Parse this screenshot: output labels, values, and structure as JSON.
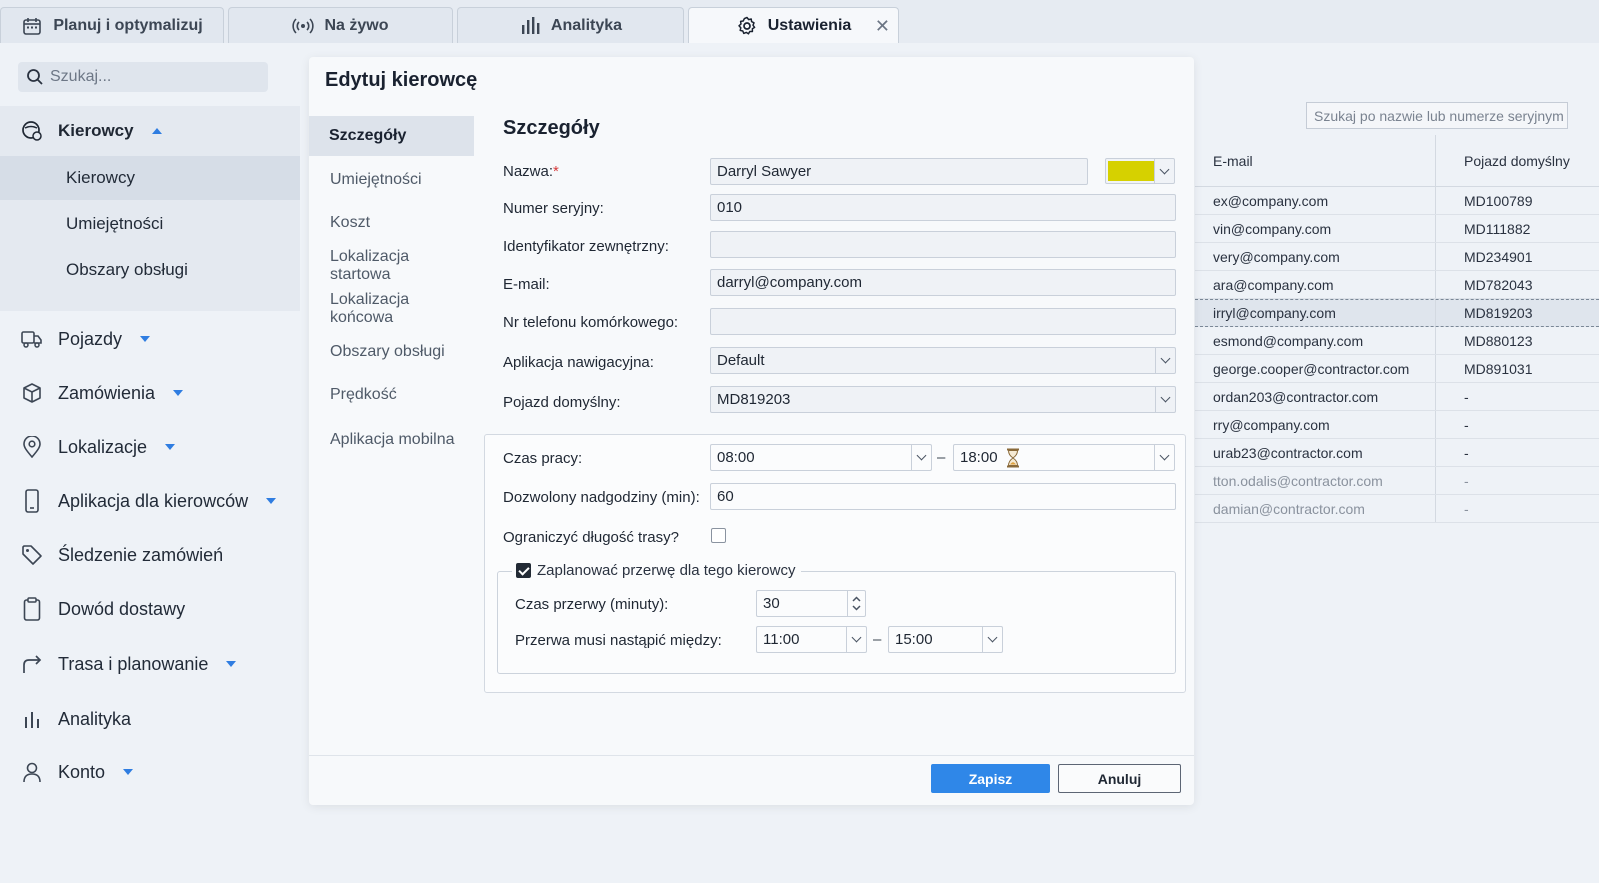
{
  "tabs": [
    {
      "label": "Planuj i optymalizuj",
      "icon": "calendar-icon"
    },
    {
      "label": "Na żywo",
      "icon": "broadcast-icon"
    },
    {
      "label": "Analityka",
      "icon": "bar-chart-icon"
    },
    {
      "label": "Ustawienia",
      "icon": "gear-icon",
      "active": true
    }
  ],
  "sidebar": {
    "search_placeholder": "Szukaj...",
    "group": {
      "label": "Kierowcy",
      "items": [
        "Kierowcy",
        "Umiejętności",
        "Obszary obsługi"
      ],
      "selected": "Kierowcy"
    },
    "items": [
      {
        "label": "Pojazdy",
        "icon": "truck-icon",
        "expandable": true
      },
      {
        "label": "Zamówienia",
        "icon": "box-icon",
        "expandable": true
      },
      {
        "label": "Lokalizacje",
        "icon": "location-pin-icon",
        "expandable": true
      },
      {
        "label": "Aplikacja dla kierowców",
        "icon": "phone-icon",
        "expandable": true
      },
      {
        "label": "Śledzenie zamówień",
        "icon": "tag-icon",
        "expandable": false
      },
      {
        "label": "Dowód dostawy",
        "icon": "clipboard-icon",
        "expandable": false
      },
      {
        "label": "Trasa i planowanie",
        "icon": "route-arrow-icon",
        "expandable": true
      },
      {
        "label": "Analityka",
        "icon": "bar-chart-icon",
        "expandable": false
      },
      {
        "label": "Konto",
        "icon": "user-icon",
        "expandable": true
      }
    ]
  },
  "background_table": {
    "search_placeholder": "Szukaj po nazwie lub numerze seryjnym",
    "columns": [
      "E-mail",
      "Pojazd domyślny"
    ],
    "rows": [
      [
        "ex@company.com",
        "MD100789"
      ],
      [
        "vin@company.com",
        "MD111882"
      ],
      [
        "very@company.com",
        "MD234901"
      ],
      [
        "ara@company.com",
        "MD782043"
      ],
      [
        "irryl@company.com",
        "MD819203"
      ],
      [
        "esmond@company.com",
        "MD880123"
      ],
      [
        "george.cooper@contractor.com",
        "MD891031"
      ],
      [
        "ordan203@contractor.com",
        "-"
      ],
      [
        "rry@company.com",
        "-"
      ],
      [
        "urab23@contractor.com",
        "-"
      ],
      [
        "tton.odalis@contractor.com",
        "-"
      ],
      [
        "damian@contractor.com",
        "-"
      ]
    ],
    "highlighted_row": 4
  },
  "dialog": {
    "title": "Edytuj kierowcę",
    "nav": [
      "Szczegóły",
      "Umiejętności",
      "Koszt",
      "Lokalizacja startowa",
      "Lokalizacja końcowa",
      "Obszary obsługi",
      "Prędkość",
      "Aplikacja mobilna"
    ],
    "nav_selected": "Szczegóły",
    "section_title": "Szczegóły",
    "fields": {
      "name": {
        "label": "Nazwa:",
        "required_mark": "*",
        "value": "Darryl Sawyer",
        "color": "#d6d100"
      },
      "serial": {
        "label": "Numer seryjny:",
        "value": "010"
      },
      "external_id": {
        "label": "Identyfikator zewnętrzny:",
        "value": ""
      },
      "email": {
        "label": "E-mail:",
        "value": "darryl@company.com"
      },
      "phone": {
        "label": "Nr telefonu komórkowego:",
        "value": ""
      },
      "nav_app": {
        "label": "Aplikacja nawigacyjna:",
        "value": "Default"
      },
      "vehicle": {
        "label": "Pojazd domyślny:",
        "value": "MD819203"
      }
    },
    "work": {
      "hours_label": "Czas pracy:",
      "start": "08:00",
      "end": "18:00",
      "separator": "–",
      "overtime_label": "Dozwolony nadgodziny (min):",
      "overtime_value": "60",
      "limit_route_label": "Ograniczyć długość trasy?",
      "limit_route_checked": false
    },
    "break": {
      "label": "Zaplanować przerwę dla tego kierowcy",
      "checked": true,
      "duration_label": "Czas przerwy (minuty):",
      "duration_value": "30",
      "window_label": "Przerwa musi nastąpić między:",
      "window_start": "11:00",
      "window_end": "15:00",
      "separator": "–"
    },
    "buttons": {
      "save": "Zapisz",
      "cancel": "Anuluj"
    }
  }
}
